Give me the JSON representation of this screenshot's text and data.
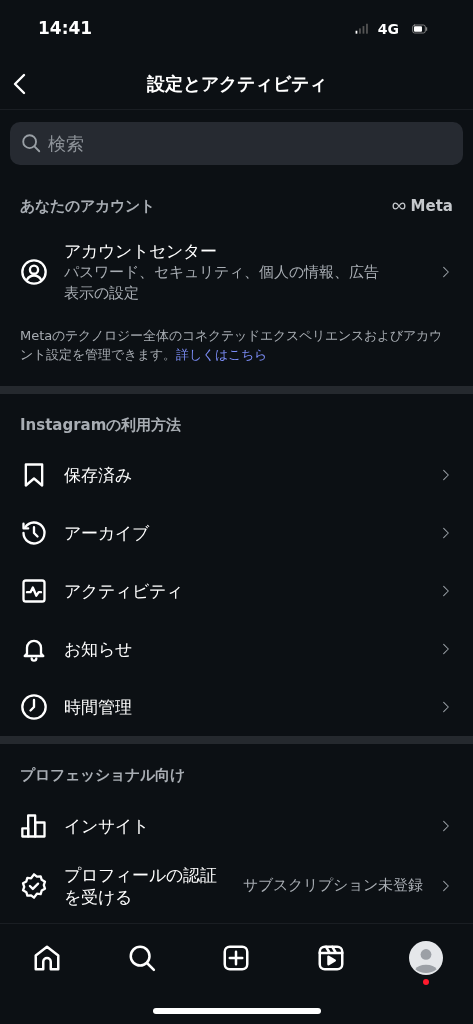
{
  "status_bar": {
    "time": "14:41",
    "network": "4G"
  },
  "header": {
    "title": "設定とアクティビティ"
  },
  "search": {
    "placeholder": "検索"
  },
  "sections": [
    {
      "heading": "あなたのアカウント",
      "brand": "Meta",
      "items": [
        {
          "kind": "account",
          "label": "アカウントセンター",
          "subtitle": "パスワード、セキュリティ、個人の情報、広告表示の設定"
        }
      ],
      "note": "Metaのテクノロジー全体のコネクテッドエクスペリエンスおよびアカウント設定を管理できます。",
      "note_link": "詳しくはこちら"
    },
    {
      "heading": "Instagramの利用方法",
      "items": [
        {
          "kind": "bookmark",
          "label": "保存済み"
        },
        {
          "kind": "archive",
          "label": "アーカイブ"
        },
        {
          "kind": "activity",
          "label": "アクティビティ"
        },
        {
          "kind": "bell",
          "label": "お知らせ"
        },
        {
          "kind": "clock",
          "label": "時間管理"
        }
      ]
    },
    {
      "heading": "プロフェッショナル向け",
      "items": [
        {
          "kind": "insights",
          "label": "インサイト"
        },
        {
          "kind": "verified",
          "label": "プロフィールの認証を受ける",
          "value": "サブスクリプション未登録"
        }
      ]
    }
  ],
  "tab_bar": [
    {
      "kind": "home"
    },
    {
      "kind": "search"
    },
    {
      "kind": "create"
    },
    {
      "kind": "reels"
    },
    {
      "kind": "profile",
      "notification": true
    }
  ]
}
